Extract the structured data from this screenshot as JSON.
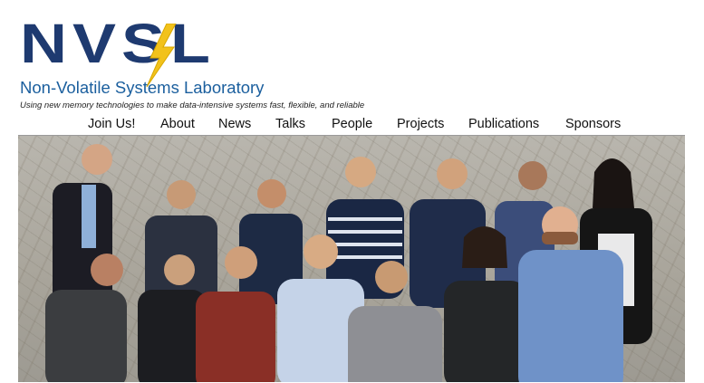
{
  "logo": {
    "letters": "NVSL",
    "name": "Non-Volatile Systems Laboratory",
    "colors": {
      "letters": "#1e3a70",
      "bolt": "#f2c21b",
      "name": "#1b5f9e"
    }
  },
  "tagline": "Using new memory technologies to make data-intensive systems fast, flexible, and reliable",
  "nav": {
    "items": [
      {
        "label": "Join Us!"
      },
      {
        "label": "About"
      },
      {
        "label": "News"
      },
      {
        "label": "Talks"
      },
      {
        "label": "People"
      },
      {
        "label": "Projects"
      },
      {
        "label": "Publications"
      },
      {
        "label": "Sponsors"
      }
    ]
  },
  "photo": {
    "subject": "group-photo"
  }
}
